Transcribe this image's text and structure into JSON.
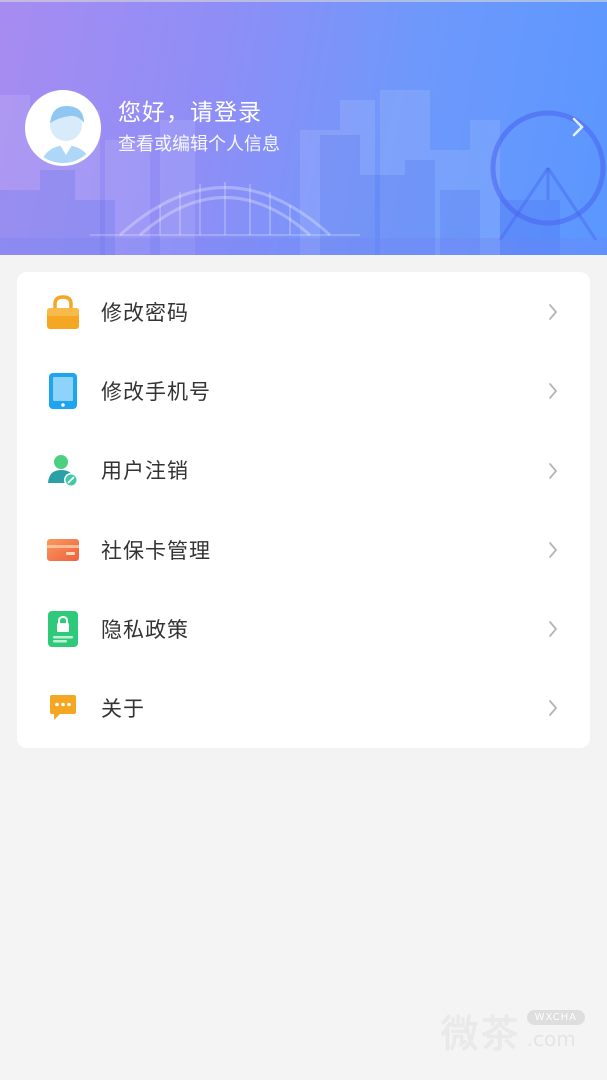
{
  "header": {
    "greeting": "您好，请登录",
    "subtext": "查看或编辑个人信息"
  },
  "menu": [
    {
      "label": "修改密码",
      "icon": "lock-icon",
      "color": "#f5a623"
    },
    {
      "label": "修改手机号",
      "icon": "phone-icon",
      "color": "#1ea5f0"
    },
    {
      "label": "用户注销",
      "icon": "user-cancel-icon",
      "color": "#3ec9a7"
    },
    {
      "label": "社保卡管理",
      "icon": "card-icon",
      "color": "#f26c4f"
    },
    {
      "label": "隐私政策",
      "icon": "privacy-icon",
      "color": "#2fc97a"
    },
    {
      "label": "关于",
      "icon": "chat-icon",
      "color": "#f5a623"
    }
  ],
  "watermark": {
    "main": "微茶",
    "badge": "WXCHA",
    "suffix": ".com"
  }
}
